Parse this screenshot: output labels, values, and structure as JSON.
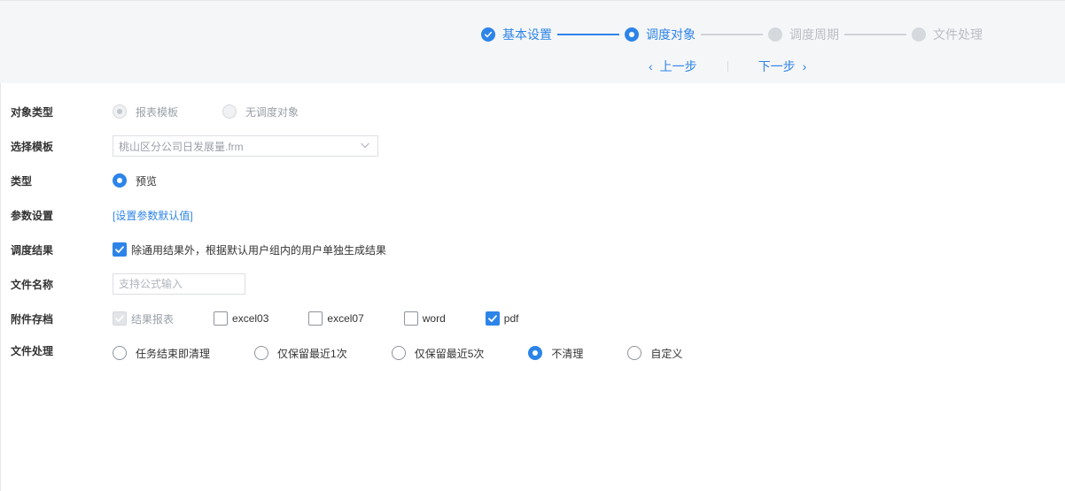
{
  "steps": [
    {
      "label": "基本设置",
      "state": "done"
    },
    {
      "label": "调度对象",
      "state": "active"
    },
    {
      "label": "调度周期",
      "state": "todo"
    },
    {
      "label": "文件处理",
      "state": "todo"
    }
  ],
  "nav": {
    "prev": "上一步",
    "next": "下一步"
  },
  "form": {
    "object_type": {
      "label": "对象类型",
      "options": [
        "报表模板",
        "无调度对象"
      ]
    },
    "template": {
      "label": "选择模板",
      "value": "桃山区分公司日发展量.frm"
    },
    "type": {
      "label": "类型",
      "option": "预览"
    },
    "params": {
      "label": "参数设置",
      "link": "[设置参数默认值]"
    },
    "result": {
      "label": "调度结果",
      "option": "除通用结果外，根据默认用户组内的用户单独生成结果"
    },
    "filename": {
      "label": "文件名称",
      "placeholder": "支持公式输入"
    },
    "attachments": {
      "label": "附件存档",
      "options": [
        "结果报表",
        "excel03",
        "excel07",
        "word",
        "pdf"
      ]
    },
    "file_handling": {
      "label": "文件处理",
      "options": [
        "任务结束即清理",
        "仅保留最近1次",
        "仅保留最近5次",
        "不清理",
        "自定义"
      ]
    }
  },
  "colors": {
    "accent": "#2d84e8",
    "band": "#f5f6f8",
    "muted": "#b9bdc4"
  }
}
